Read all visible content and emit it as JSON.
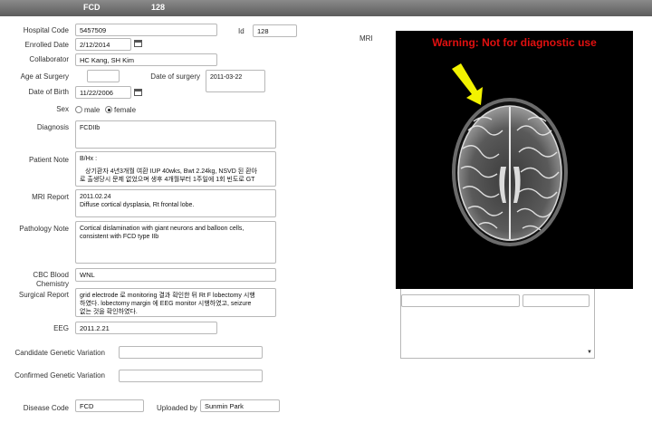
{
  "titlebar": {
    "left_label": "FCD",
    "right_label": "128"
  },
  "form": {
    "hospital_code": {
      "label": "Hospital Code",
      "value": "5457509"
    },
    "id": {
      "label": "Id",
      "value": "128"
    },
    "enrolled_date": {
      "label": "Enrolled Date",
      "value": "2/12/2014"
    },
    "collaborator": {
      "label": "Collaborator",
      "value": "HC Kang, SH Kim"
    },
    "age_at_surgery": {
      "label": "Age at Surgery",
      "value": ""
    },
    "date_of_surgery": {
      "label": "Date of surgery",
      "value": "2011-03-22"
    },
    "date_of_birth": {
      "label": "Date of Birth",
      "value": "11/22/2006"
    },
    "sex": {
      "label": "Sex",
      "options": [
        "male",
        "female"
      ],
      "selected": "female"
    },
    "diagnosis": {
      "label": "Diagnosis",
      "value": "FCDIIb"
    },
    "patient_note": {
      "label": "Patient Note",
      "lines": [
        "B/Hx :",
        "",
        "상기환자 4년3개월 여환 IUP 40wks, Bwt 2.24kg, NSVD 된 환아",
        "로 출생당시 문제 없었으며 생후 4개월부터 1주일에 1회 빈도로 GT"
      ]
    },
    "mri_report": {
      "label": "MRI Report",
      "lines": [
        "2011.02.24",
        "Diffuse cortical dysplasia, Rt frontal lobe."
      ]
    },
    "pathology_note": {
      "label": "Pathology Note",
      "lines": [
        "Cortical dislamination with giant neurons and balloon cells,",
        "consistent with FCD type IIb"
      ]
    },
    "cbc_blood_chemistry": {
      "label": "CBC Blood Chemistry",
      "value": "WNL"
    },
    "surgical_report": {
      "label": "Surgical Report",
      "lines": [
        "grid electrode 로 monitoring 결과 확인한 뒤 Rt F lobectomy 시행",
        "하였다. lobectomy margin 에 EEG monitor 시행하였고, seizure",
        "없는 것을 확인하였다."
      ]
    },
    "eeg": {
      "label": "EEG",
      "value": "2011.2.21"
    },
    "candidate_genetic_variation": {
      "label": "Candidate Genetic Variation",
      "value": ""
    },
    "confirmed_genetic_variation": {
      "label": "Confirmed Genetic Variation",
      "value": ""
    },
    "disease_code": {
      "label": "Disease Code",
      "value": "FCD"
    },
    "uploaded_by": {
      "label": "Uploaded by",
      "value": "Sunmin Park"
    }
  },
  "mri_panel": {
    "label": "MRI",
    "warning": "Warning: Not for diagnostic use",
    "warning_color": "#e01010",
    "arrow_color": "#f2f200",
    "scroll_down_icon": "triangle-down-icon"
  }
}
